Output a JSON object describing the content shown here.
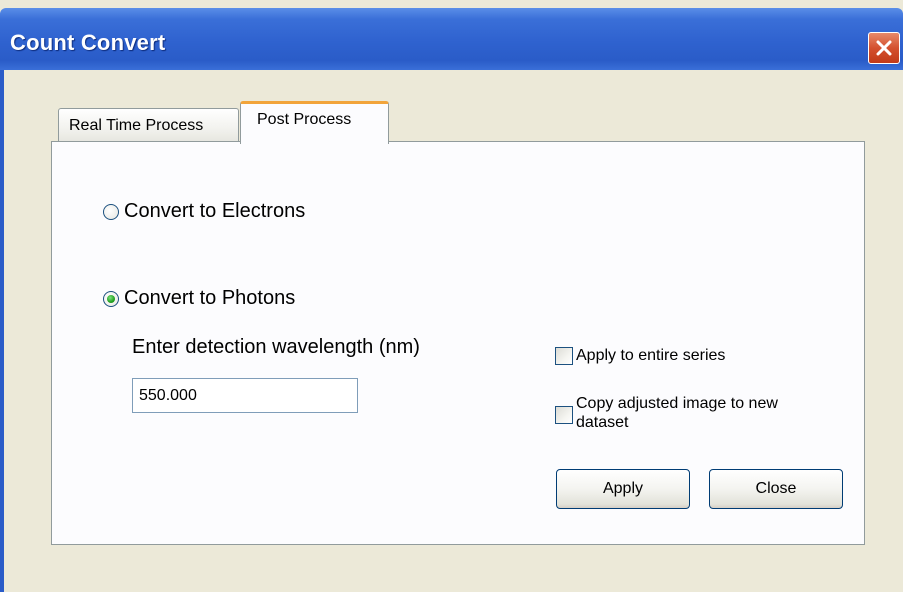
{
  "window": {
    "title": "Count Convert",
    "close_icon": "close-icon"
  },
  "tabs": [
    {
      "label": "Real Time Process",
      "active": false
    },
    {
      "label": "Post Process",
      "active": true
    }
  ],
  "post_process": {
    "radio_electrons": {
      "label": "Convert to Electrons",
      "checked": false
    },
    "radio_photons": {
      "label": "Convert to Photons",
      "checked": true
    },
    "wavelength_label": "Enter detection wavelength (nm)",
    "wavelength_value": "550.000",
    "checkbox_series": {
      "label": "Apply to entire series",
      "checked": false
    },
    "checkbox_copy": {
      "label_line1": "Copy adjusted image to new",
      "label_line2": "dataset",
      "checked": false
    },
    "apply_label": "Apply",
    "close_label": "Close"
  },
  "colors": {
    "titlebar": "#2f62cf",
    "window_bg": "#ece9d8",
    "active_tab_accent": "#f2a43a",
    "close_button": "#d4512f"
  }
}
